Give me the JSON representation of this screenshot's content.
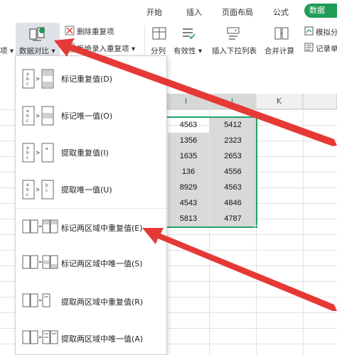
{
  "tabs": {
    "start": "开始",
    "insert": "插入",
    "page_layout": "页面布局",
    "formula": "公式",
    "data": "数据"
  },
  "ribbon": {
    "left_cut": "项",
    "remove_duplicates": "删除重复项",
    "reject_duplicates": "拒绝录入重复项",
    "data_compare": "数据对比",
    "split": "分列",
    "validity": "有效性",
    "insert_dropdown": "插入下拉列表",
    "consolidate": "合并计算",
    "simulate_partial": "模拟分",
    "record_partial": "记录单"
  },
  "sheet": {
    "col_i_1": "I",
    "col_i_2": "I",
    "col_k": "K",
    "rows": [
      [
        "4563",
        "5412"
      ],
      [
        "1356",
        "2323"
      ],
      [
        "1635",
        "2653"
      ],
      [
        "136",
        "4556"
      ],
      [
        "8929",
        "4563"
      ],
      [
        "4543",
        "4846"
      ],
      [
        "5813",
        "4787"
      ]
    ]
  },
  "menu": {
    "items": [
      {
        "label": "标记重复值(D)"
      },
      {
        "label": "标记唯一值(O)"
      },
      {
        "label": "提取重复值(I)"
      },
      {
        "label": "提取唯一值(U)"
      },
      {
        "label": "标记两区域中重复值(E)"
      },
      {
        "label": "标记两区域中唯一值(S)"
      },
      {
        "label": "提取两区域中重复值(R)"
      },
      {
        "label": "提取两区域中唯一值(A)"
      }
    ]
  },
  "colors": {
    "accent_green": "#1f9d55",
    "selection_green": "#21a366",
    "annotation_red": "#e53935"
  }
}
